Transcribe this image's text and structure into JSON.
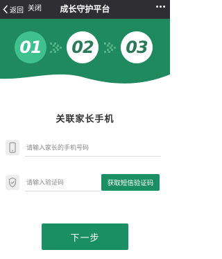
{
  "nav": {
    "back_label": "返回",
    "close_label": "关闭",
    "title": "成长守护平台",
    "more_icon": "ellipsis-icon"
  },
  "steps": [
    {
      "label": "01",
      "state": "active"
    },
    {
      "label": "02",
      "state": "inactive"
    },
    {
      "label": "03",
      "state": "inactive"
    }
  ],
  "form": {
    "heading": "关联家长手机",
    "phone": {
      "placeholder": "请输入家长的手机号码",
      "value": "",
      "icon": "phone-icon"
    },
    "code": {
      "placeholder": "请输入验证码",
      "value": "",
      "icon": "shield-check-icon"
    },
    "sms_button": "获取短信验证码",
    "next_button": "下一步"
  },
  "colors": {
    "nav_bg": "#2f2f33",
    "brand_green": "#1a8f63",
    "step_active": "#3ec08f",
    "banner_green": "#1f8a60"
  }
}
